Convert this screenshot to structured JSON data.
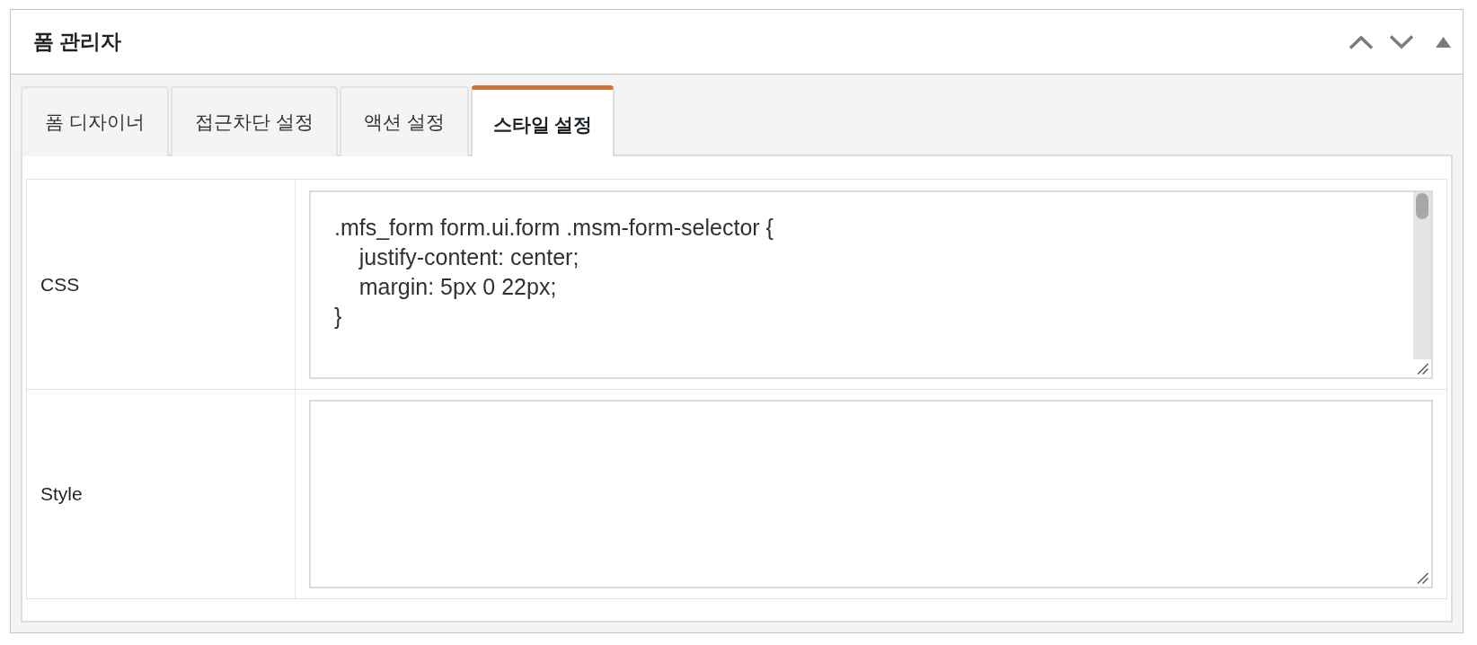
{
  "panel": {
    "title": "폼 관리자"
  },
  "tabs": [
    {
      "label": "폼 디자이너",
      "selected": false
    },
    {
      "label": "접근차단 설정",
      "selected": false
    },
    {
      "label": "액션 설정",
      "selected": false
    },
    {
      "label": "스타일 설정",
      "selected": true
    }
  ],
  "fields": [
    {
      "label": "CSS",
      "value": ".mfs_form form.ui.form .msm-form-selector {\n    justify-content: center;\n    margin: 5px 0 22px;\n}"
    },
    {
      "label": "Style"
    }
  ]
}
